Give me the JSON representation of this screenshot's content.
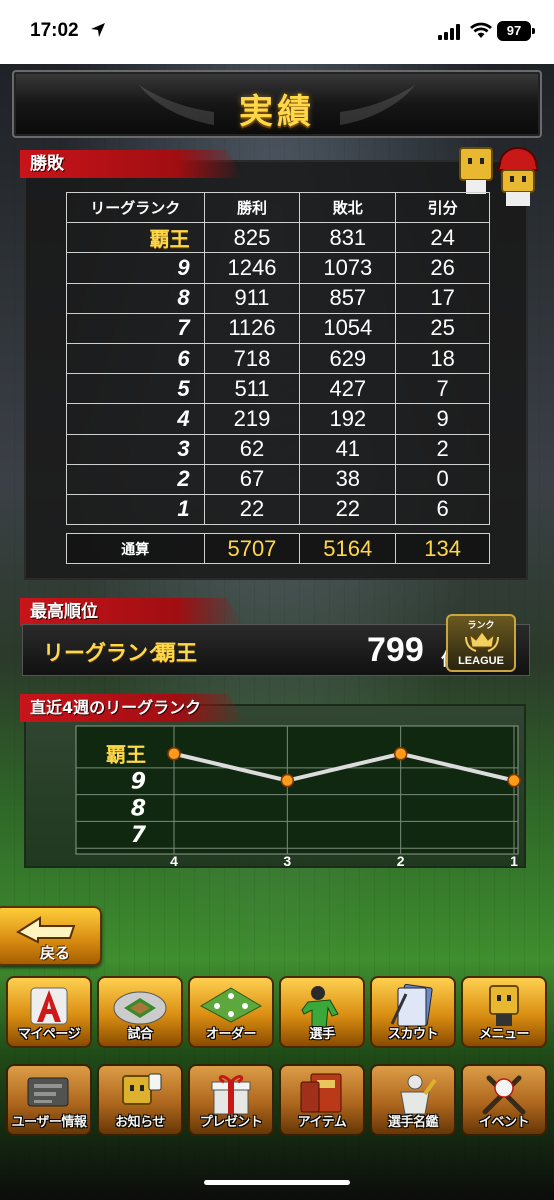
{
  "status_bar": {
    "time": "17:02",
    "battery": "97"
  },
  "page": {
    "title": "実績"
  },
  "record": {
    "section_label": "勝敗",
    "headers": [
      "リーグランク",
      "勝利",
      "敗北",
      "引分"
    ],
    "rows": [
      {
        "rank": "覇王",
        "wins": "825",
        "losses": "831",
        "draws": "24"
      },
      {
        "rank": "9",
        "wins": "1246",
        "losses": "1073",
        "draws": "26"
      },
      {
        "rank": "8",
        "wins": "911",
        "losses": "857",
        "draws": "17"
      },
      {
        "rank": "7",
        "wins": "1126",
        "losses": "1054",
        "draws": "25"
      },
      {
        "rank": "6",
        "wins": "718",
        "losses": "629",
        "draws": "18"
      },
      {
        "rank": "5",
        "wins": "511",
        "losses": "427",
        "draws": "7"
      },
      {
        "rank": "4",
        "wins": "219",
        "losses": "192",
        "draws": "9"
      },
      {
        "rank": "3",
        "wins": "62",
        "losses": "41",
        "draws": "2"
      },
      {
        "rank": "2",
        "wins": "67",
        "losses": "38",
        "draws": "0"
      },
      {
        "rank": "1",
        "wins": "22",
        "losses": "22",
        "draws": "6"
      }
    ],
    "total": {
      "label": "通算",
      "wins": "5707",
      "losses": "5164",
      "draws": "134"
    }
  },
  "best_rank": {
    "section_label": "最高順位",
    "label": "リーグランク",
    "rank": "覇王",
    "position": "799",
    "position_unit": "位",
    "badge_top": "ランク",
    "badge_bottom": "LEAGUE"
  },
  "recent": {
    "section_label": "直近4週のリーグランク"
  },
  "chart_data": {
    "type": "line",
    "x": [
      "4",
      "3",
      "2",
      "1"
    ],
    "y_categories": [
      "7",
      "8",
      "9",
      "覇王"
    ],
    "series": [
      {
        "values": [
          "覇王",
          "9",
          "覇王",
          "9"
        ]
      }
    ],
    "line_color": "#dcdcdc",
    "marker_color": "#ff9a1a"
  },
  "back_button": {
    "label": "戻る"
  },
  "nav_top": [
    {
      "label": "マイページ",
      "icon": "mypage-a-icon"
    },
    {
      "label": "試合",
      "icon": "stadium-icon"
    },
    {
      "label": "オーダー",
      "icon": "field-order-icon"
    },
    {
      "label": "選手",
      "icon": "player-icon"
    },
    {
      "label": "スカウト",
      "icon": "scout-card-icon"
    },
    {
      "label": "メニュー",
      "icon": "menu-mascot-icon"
    }
  ],
  "nav_bottom": [
    {
      "label": "ユーザー情報",
      "icon": "user-info-icon"
    },
    {
      "label": "お知らせ",
      "icon": "notice-mascot-icon"
    },
    {
      "label": "プレゼント",
      "icon": "gift-icon"
    },
    {
      "label": "アイテム",
      "icon": "item-book-icon"
    },
    {
      "label": "選手名鑑",
      "icon": "player-book-icon"
    },
    {
      "label": "イベント",
      "icon": "event-bats-icon"
    }
  ],
  "colors": {
    "accent_gold": "#ffd84a",
    "section_red": "#c8141a"
  }
}
